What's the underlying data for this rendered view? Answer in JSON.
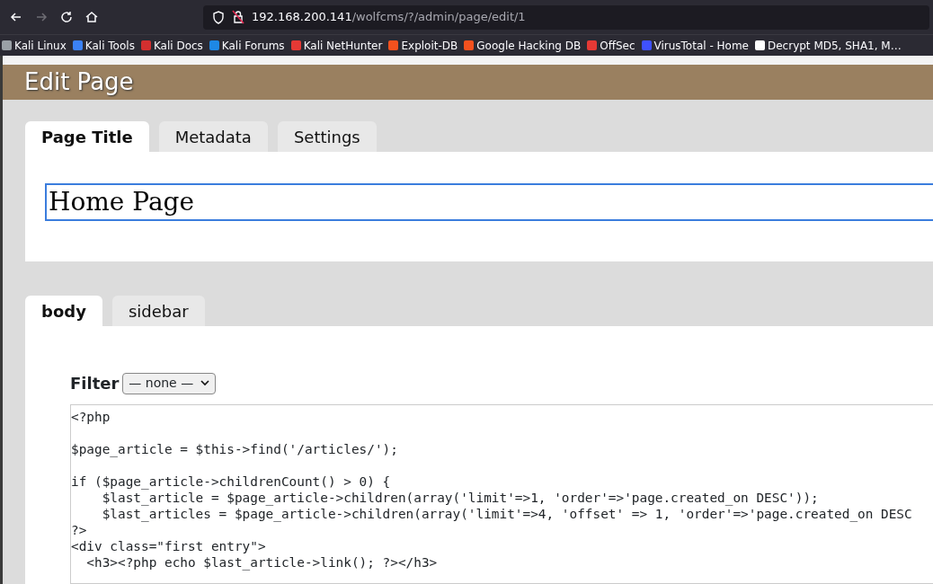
{
  "browser": {
    "nav_buttons": [
      {
        "kind": "back",
        "disabled": false
      },
      {
        "kind": "forward",
        "disabled": true
      },
      {
        "kind": "reload",
        "disabled": false
      },
      {
        "kind": "home",
        "disabled": false
      }
    ],
    "url": {
      "host": "192.168.200.141",
      "path": "/wolfcms/?/admin/page/edit/1"
    },
    "bookmarks": [
      {
        "label": "Kali Linux",
        "color": "#9aa0a6"
      },
      {
        "label": "Kali Tools",
        "color": "#3b82f6"
      },
      {
        "label": "Kali Docs",
        "color": "#d32f2f"
      },
      {
        "label": "Kali Forums",
        "color": "#1e88e5"
      },
      {
        "label": "Kali NetHunter",
        "color": "#e53935"
      },
      {
        "label": "Exploit-DB",
        "color": "#f4511e"
      },
      {
        "label": "Google Hacking DB",
        "color": "#f4511e"
      },
      {
        "label": "OffSec",
        "color": "#e53935"
      },
      {
        "label": "VirusTotal - Home",
        "color": "#3f51ff"
      },
      {
        "label": "Decrypt MD5, SHA1, M…",
        "color": "#ffffff"
      }
    ]
  },
  "header": {
    "title": "Edit Page"
  },
  "page_tabs": [
    {
      "label": "Page Title",
      "selected": true
    },
    {
      "label": "Metadata",
      "selected": false
    },
    {
      "label": "Settings",
      "selected": false
    }
  ],
  "title_field": {
    "value": "Home Page"
  },
  "part_tabs": [
    {
      "label": "body",
      "selected": true
    },
    {
      "label": "sidebar",
      "selected": false
    }
  ],
  "filter": {
    "label": "Filter",
    "value": "— none —"
  },
  "code_paragraphs": [
    [
      "<?php"
    ],
    [
      "$page_article = $this->find('/articles/');"
    ],
    [
      "if ($page_article->childrenCount() > 0) {",
      "    $last_article = $page_article->children(array('limit'=>1, 'order'=>'page.created_on DESC'));",
      "    $last_articles = $page_article->children(array('limit'=>4, 'offset' => 1, 'order'=>'page.created_on DESC",
      "?>",
      "<div class=\"first entry\">",
      "  <h3><?php echo $last_article->link(); ?></h3>"
    ]
  ]
}
